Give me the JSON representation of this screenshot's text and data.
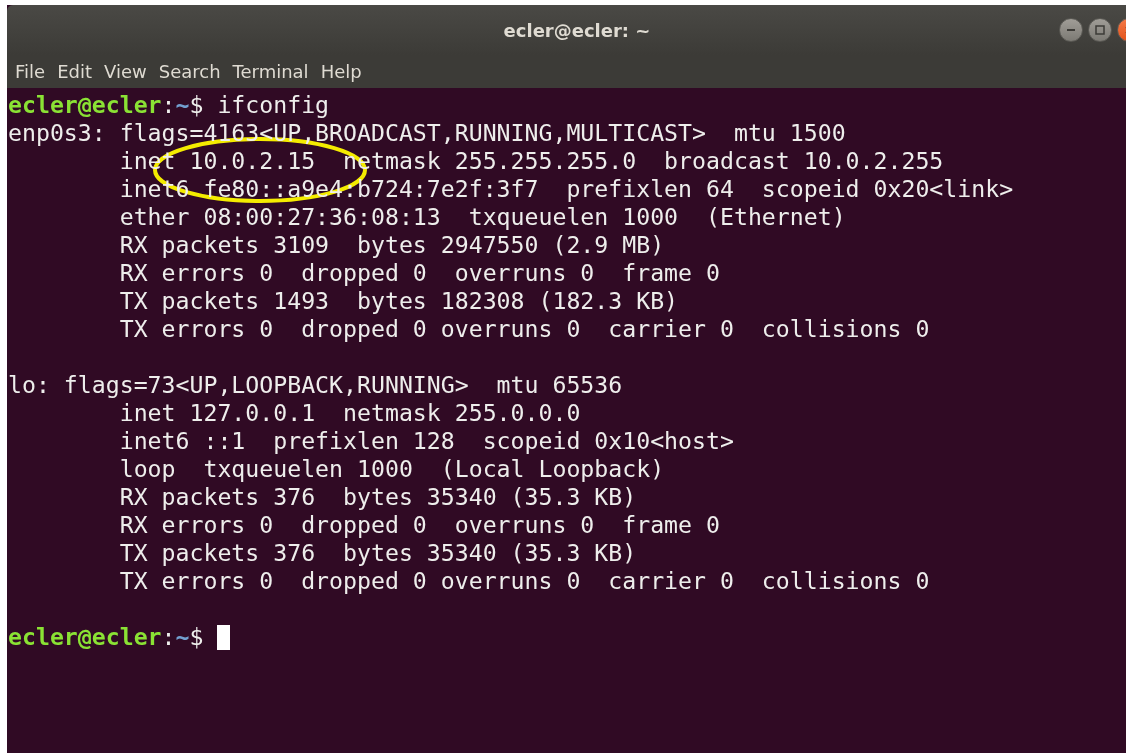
{
  "window": {
    "title": "ecler@ecler: ~"
  },
  "menu": [
    "File",
    "Edit",
    "View",
    "Search",
    "Terminal",
    "Help"
  ],
  "terminal": {
    "lines": [
      {
        "kind": "prompt",
        "user_host": "ecler@ecler",
        "separator": ":",
        "path": "~",
        "symbol": "$",
        "command": "ifconfig",
        "cursor": false
      },
      {
        "kind": "output",
        "text": "enp0s3: flags=4163<UP,BROADCAST,RUNNING,MULTICAST>  mtu 1500"
      },
      {
        "kind": "output",
        "text": "        inet 10.0.2.15  netmask 255.255.255.0  broadcast 10.0.2.255"
      },
      {
        "kind": "output",
        "text": "        inet6 fe80::a9e4:b724:7e2f:3f7  prefixlen 64  scopeid 0x20<link>"
      },
      {
        "kind": "output",
        "text": "        ether 08:00:27:36:08:13  txqueuelen 1000  (Ethernet)"
      },
      {
        "kind": "output",
        "text": "        RX packets 3109  bytes 2947550 (2.9 MB)"
      },
      {
        "kind": "output",
        "text": "        RX errors 0  dropped 0  overruns 0  frame 0"
      },
      {
        "kind": "output",
        "text": "        TX packets 1493  bytes 182308 (182.3 KB)"
      },
      {
        "kind": "output",
        "text": "        TX errors 0  dropped 0 overruns 0  carrier 0  collisions 0"
      },
      {
        "kind": "blank"
      },
      {
        "kind": "output",
        "text": "lo: flags=73<UP,LOOPBACK,RUNNING>  mtu 65536"
      },
      {
        "kind": "output",
        "text": "        inet 127.0.0.1  netmask 255.0.0.0"
      },
      {
        "kind": "output",
        "text": "        inet6 ::1  prefixlen 128  scopeid 0x10<host>"
      },
      {
        "kind": "output",
        "text": "        loop  txqueuelen 1000  (Local Loopback)"
      },
      {
        "kind": "output",
        "text": "        RX packets 376  bytes 35340 (35.3 KB)"
      },
      {
        "kind": "output",
        "text": "        RX errors 0  dropped 0  overruns 0  frame 0"
      },
      {
        "kind": "output",
        "text": "        TX packets 376  bytes 35340 (35.3 KB)"
      },
      {
        "kind": "output",
        "text": "        TX errors 0  dropped 0 overruns 0  carrier 0  collisions 0"
      },
      {
        "kind": "blank"
      },
      {
        "kind": "prompt",
        "user_host": "ecler@ecler",
        "separator": ":",
        "path": "~",
        "symbol": "$",
        "cursor": true
      }
    ]
  }
}
